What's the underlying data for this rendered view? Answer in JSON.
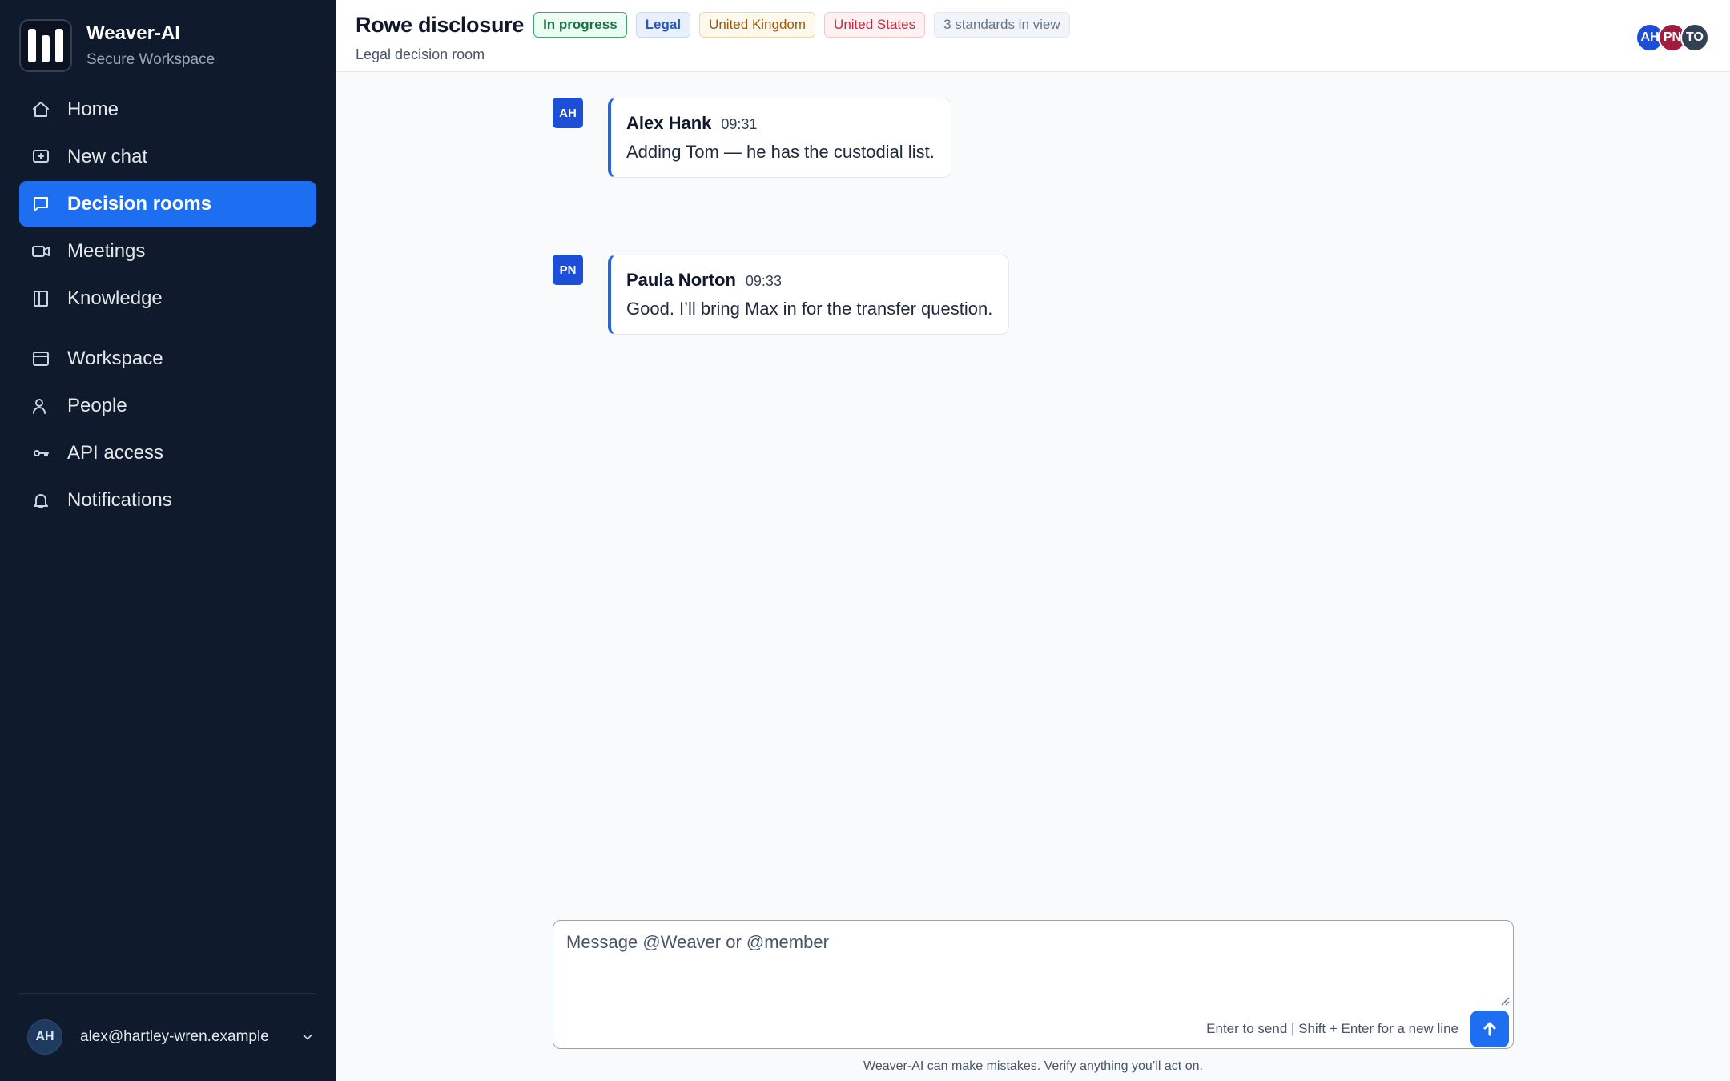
{
  "brand": {
    "name": "Weaver-AI",
    "subtitle": "Secure Workspace"
  },
  "sidebar": {
    "primary": [
      {
        "label": "Home",
        "icon": "home-icon"
      },
      {
        "label": "New chat",
        "icon": "new-chat-icon"
      },
      {
        "label": "Decision rooms",
        "icon": "chat-bubble-icon",
        "active": true
      },
      {
        "label": "Meetings",
        "icon": "video-icon"
      },
      {
        "label": "Knowledge",
        "icon": "book-icon"
      }
    ],
    "secondary": [
      {
        "label": "Workspace",
        "icon": "window-icon"
      },
      {
        "label": "People",
        "icon": "person-icon"
      },
      {
        "label": "API access",
        "icon": "key-icon"
      },
      {
        "label": "Notifications",
        "icon": "bell-icon"
      }
    ],
    "account": {
      "initials": "AH",
      "email": "alex@hartley-wren.example"
    }
  },
  "header": {
    "title": "Rowe disclosure",
    "subtitle": "Legal decision room",
    "tags": {
      "status": "In progress",
      "practice": "Legal",
      "jurisdiction_1": "United Kingdom",
      "jurisdiction_2": "United States",
      "standards": "3 standards in view"
    },
    "participants": [
      {
        "initials": "AH",
        "color": "#1d4ed8"
      },
      {
        "initials": "PN",
        "color": "#9f1d3f"
      },
      {
        "initials": "TO",
        "color": "#334155"
      }
    ]
  },
  "messages": [
    {
      "initials": "AH",
      "author": "Alex Hank",
      "time": "09:31",
      "text": "Adding Tom — he has the custodial list."
    },
    {
      "initials": "PN",
      "author": "Paula Norton",
      "time": "09:33",
      "text": "Good. I’ll bring Max in for the transfer question."
    }
  ],
  "composer": {
    "placeholder": "Message @Weaver or @member",
    "hint": "Enter to send | Shift + Enter for a new line",
    "disclaimer": "Weaver-AI can make mistakes. Verify anything you’ll act on."
  },
  "colors": {
    "sidebar_bg": "#0f1b2d",
    "accent": "#1d6ef0",
    "avatar_blue": "#1d4ed8"
  }
}
